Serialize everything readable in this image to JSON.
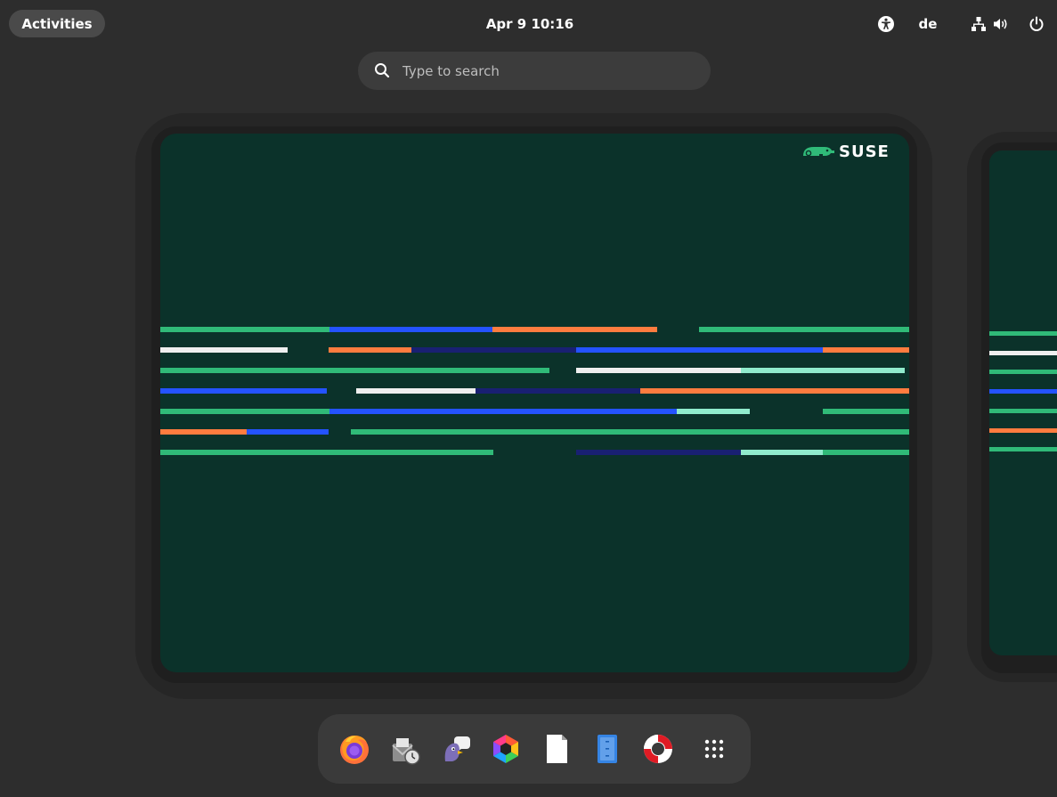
{
  "topbar": {
    "activities_label": "Activities",
    "clock": "Apr 9  10:16",
    "keyboard_layout": "de",
    "tray_icons": [
      "accessibility-icon",
      "network-icon",
      "volume-icon",
      "power-icon"
    ]
  },
  "search": {
    "placeholder": "Type to search",
    "icon": "search-icon"
  },
  "workspaces": [
    {
      "name": "workspace-1",
      "wallpaper": {
        "brand": "SUSE",
        "background_color": "#0b322a"
      }
    },
    {
      "name": "workspace-2",
      "wallpaper": {
        "background_color": "#0b322a"
      }
    }
  ],
  "dash": {
    "apps": [
      {
        "name": "firefox",
        "icon": "firefox-icon"
      },
      {
        "name": "mail-calendar",
        "icon": "mail-clock-icon"
      },
      {
        "name": "pidgin",
        "icon": "pidgin-icon"
      },
      {
        "name": "color-app",
        "icon": "hexagon-color-icon"
      },
      {
        "name": "document",
        "icon": "document-icon"
      },
      {
        "name": "files",
        "icon": "file-manager-icon"
      },
      {
        "name": "help",
        "icon": "lifebuoy-icon"
      },
      {
        "name": "show-apps",
        "icon": "app-grid-icon"
      }
    ]
  },
  "colors": {
    "panel_bg": "#2d2d2d",
    "wallpaper_bg": "#0b322a",
    "green": "#30ba78",
    "blue": "#2453ff",
    "orange": "#fe7c3f",
    "navy": "#192072",
    "white": "#efefef",
    "mint": "#90ebcd"
  }
}
